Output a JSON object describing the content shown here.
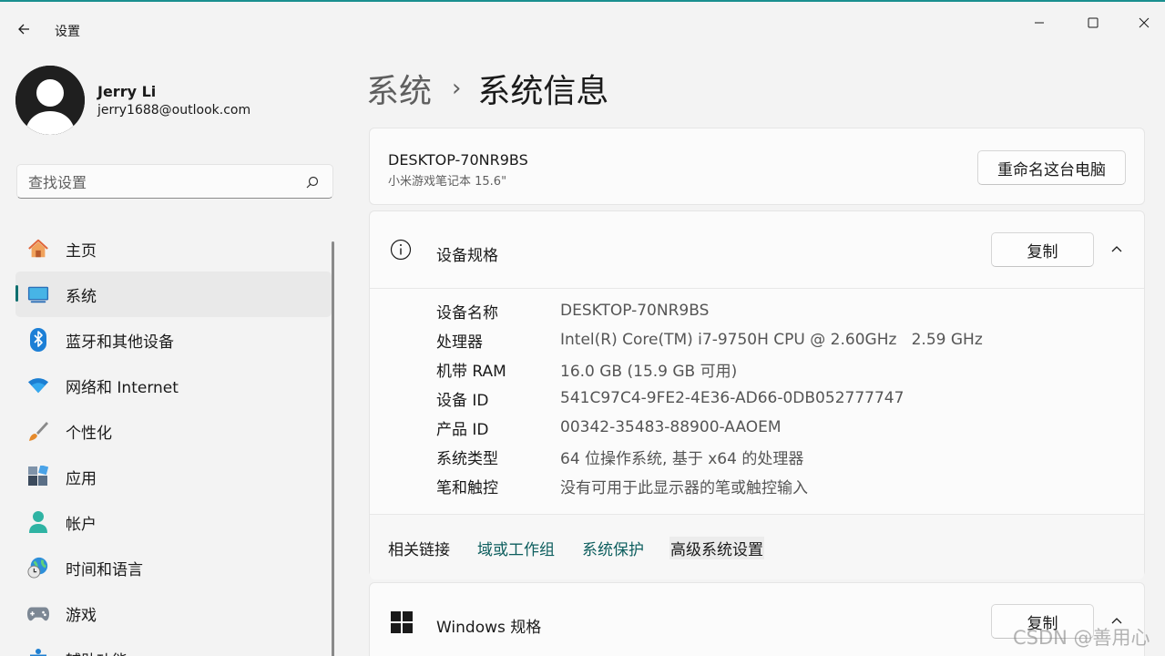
{
  "app": {
    "title": "设置"
  },
  "window_controls": {
    "minimize": "minimize",
    "maximize": "maximize",
    "close": "close"
  },
  "user": {
    "name": "Jerry Li",
    "email": "jerry1688@outlook.com"
  },
  "search": {
    "placeholder": "查找设置"
  },
  "sidebar": {
    "items": [
      {
        "label": "主页",
        "icon": "home-icon"
      },
      {
        "label": "系统",
        "icon": "system-icon",
        "active": true
      },
      {
        "label": "蓝牙和其他设备",
        "icon": "bluetooth-icon"
      },
      {
        "label": "网络和 Internet",
        "icon": "wifi-icon"
      },
      {
        "label": "个性化",
        "icon": "brush-icon"
      },
      {
        "label": "应用",
        "icon": "apps-icon"
      },
      {
        "label": "帐户",
        "icon": "account-icon"
      },
      {
        "label": "时间和语言",
        "icon": "globe-clock-icon"
      },
      {
        "label": "游戏",
        "icon": "gamepad-icon"
      },
      {
        "label": "辅助功能",
        "icon": "accessibility-icon"
      }
    ]
  },
  "breadcrumb": {
    "parent": "系统",
    "separator": "›",
    "current": "系统信息"
  },
  "device": {
    "name": "DESKTOP-70NR9BS",
    "model": "小米游戏笔记本 15.6\"",
    "rename_label": "重命名这台电脑"
  },
  "device_specs": {
    "title": "设备规格",
    "copy_label": "复制",
    "rows": [
      {
        "key": "设备名称",
        "value": "DESKTOP-70NR9BS"
      },
      {
        "key": "处理器",
        "value": "Intel(R) Core(TM) i7-9750H CPU @ 2.60GHz   2.59 GHz"
      },
      {
        "key": "机带 RAM",
        "value": "16.0 GB (15.9 GB 可用)"
      },
      {
        "key": "设备 ID",
        "value": "541C97C4-9FE2-4E36-AD66-0DB052777747"
      },
      {
        "key": "产品 ID",
        "value": "00342-35483-88900-AAOEM"
      },
      {
        "key": "系统类型",
        "value": "64 位操作系统, 基于 x64 的处理器"
      },
      {
        "key": "笔和触控",
        "value": "没有可用于此显示器的笔或触控输入"
      }
    ]
  },
  "related": {
    "label": "相关链接",
    "links": [
      "域或工作组",
      "系统保护",
      "高级系统设置"
    ]
  },
  "windows_specs": {
    "title": "Windows 规格",
    "copy_label": "复制"
  },
  "watermark": "CSDN @善用心",
  "colors": {
    "accent": "#0f6f6f",
    "link": "#0d5e5e",
    "background": "#f3f3f3",
    "card": "#fbfbfb"
  }
}
